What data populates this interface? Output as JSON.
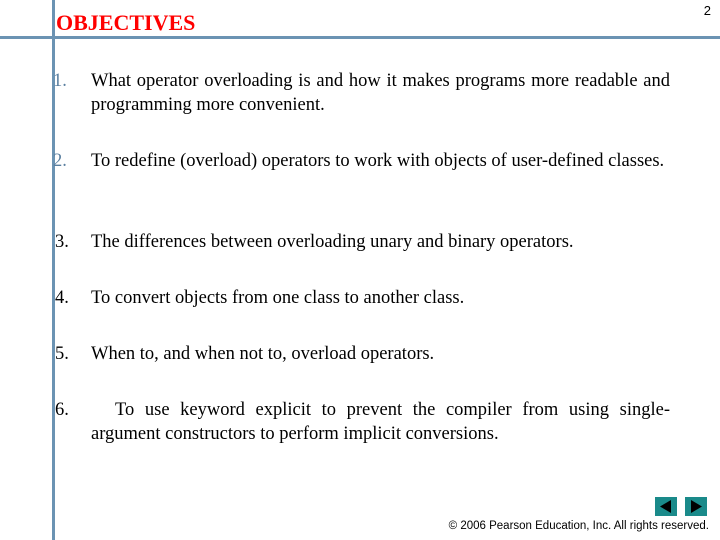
{
  "slide": {
    "title": "OBJECTIVES",
    "page_number": "2",
    "accent_color": "#ff0000",
    "rule_color": "#6b93b3",
    "nav_color": "#1a8a8a"
  },
  "objectives": [
    {
      "number": "1.",
      "text": "What operator overloading is and how it makes programs more readable and programming more convenient."
    },
    {
      "number": "2.",
      "text": "To redefine (overload) operators to work with objects of user-defined classes."
    },
    {
      "number": "3.",
      "text": "The differences between overloading unary and binary operators."
    },
    {
      "number": "4.",
      "text": "To convert objects from one class to another class."
    },
    {
      "number": "5.",
      "text": "When to, and when not to, overload operators."
    },
    {
      "number": "6.",
      "text": "To use keyword explicit to prevent the compiler from using single-argument constructors to perform implicit conversions."
    }
  ],
  "navigation": {
    "previous_icon": "triangle-left-icon",
    "next_icon": "triangle-right-icon"
  },
  "footer": {
    "copyright": "© 2006 Pearson Education, Inc.  All rights reserved."
  }
}
